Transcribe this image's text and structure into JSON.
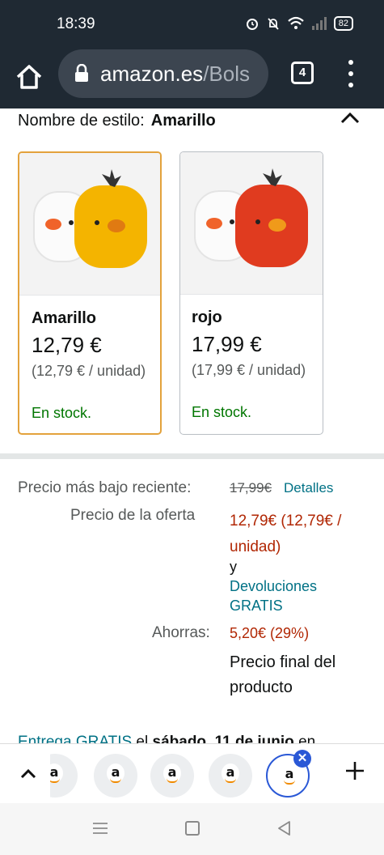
{
  "status_bar": {
    "time": "18:39",
    "battery": "82",
    "icons": [
      "alarm-icon",
      "mute-icon",
      "wifi-icon",
      "signal-icon"
    ]
  },
  "browser": {
    "url_host": "amazon.es",
    "url_path": "/Bols",
    "tab_count": "4"
  },
  "style_selector": {
    "label": "Nombre de estilo:",
    "selected": "Amarillo",
    "options": [
      {
        "name": "Amarillo",
        "price": "12,79 €",
        "unit_price": "(12,79 € / unidad)",
        "stock": "En stock.",
        "body_color": "#f4b400"
      },
      {
        "name": "rojo",
        "price": "17,99 €",
        "unit_price": "(17,99 € / unidad)",
        "stock": "En stock.",
        "body_color": "#e03b1f"
      }
    ]
  },
  "pricing": {
    "lowest_label": "Precio más bajo reciente:",
    "lowest_value": "17,99€",
    "details_link": "Detalles",
    "offer_label": "Precio de la oferta",
    "offer_value": "12,79€ (12,79€ / unidad)",
    "and_text": "y",
    "returns_link": "Devoluciones GRATIS",
    "savings_label": "Ahorras:",
    "savings_value": "5,20€ (29%)",
    "final_price_text": "Precio final del producto"
  },
  "delivery": {
    "link": "Entrega GRATIS",
    "text": " el ",
    "date": "sábado, 11 de junio",
    "suffix": " en"
  },
  "tab_strip": {
    "tabs": [
      "a",
      "a",
      "a",
      "a"
    ]
  },
  "colors": {
    "toolbar": "#1f2933",
    "price_red": "#b12704",
    "link": "#007185",
    "stock_green": "#007600",
    "selected_border": "#e3a23c",
    "active_tab": "#2a58d6"
  }
}
